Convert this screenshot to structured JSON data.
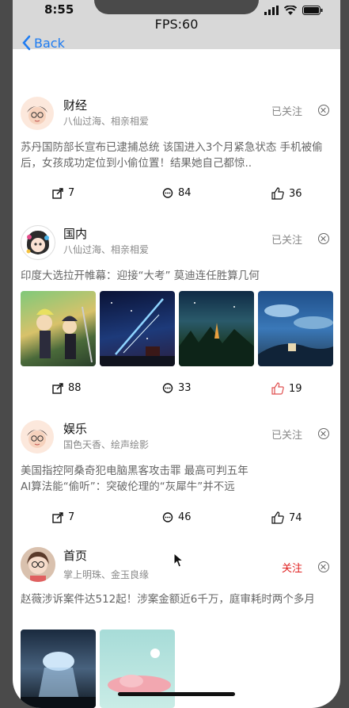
{
  "status": {
    "time": "8:55",
    "fps": "FPS:60"
  },
  "nav": {
    "back_label": "Back"
  },
  "cards": [
    {
      "title": "财经",
      "subtitle": "八仙过海、相亲相爱",
      "follow": "已关注",
      "text": "苏丹国防部长宣布已逮捕总统 该国进入3个月紧急状态 手机被偷后，女孩成功定位到小偷位置！结果她自己都惊..",
      "share": "7",
      "comments": "84",
      "likes": "36"
    },
    {
      "title": "国内",
      "subtitle": "八仙过海、相亲相爱",
      "follow": "已关注",
      "text": "印度大选拉开帷幕：迎接“大考” 莫迪连任胜算几何",
      "share": "88",
      "comments": "33",
      "likes": "19"
    },
    {
      "title": "娱乐",
      "subtitle": "国色天香、绘声绘影",
      "follow": "已关注",
      "text": "美国指控阿桑奇犯电脑黑客攻击罪 最高可判五年\nAI算法能“偷听”：突破伦理的“灰犀牛”并不远",
      "share": "7",
      "comments": "46",
      "likes": "74"
    },
    {
      "title": "首页",
      "subtitle": "掌上明珠、金玉良缘",
      "follow": "关注",
      "text": "赵薇涉诉案件达512起！涉案金额近6千万，庭审耗时两个多月"
    }
  ],
  "colors": {
    "accent": "#1e7cf2",
    "follow_red": "#e02020",
    "like_active": "#e05050"
  }
}
